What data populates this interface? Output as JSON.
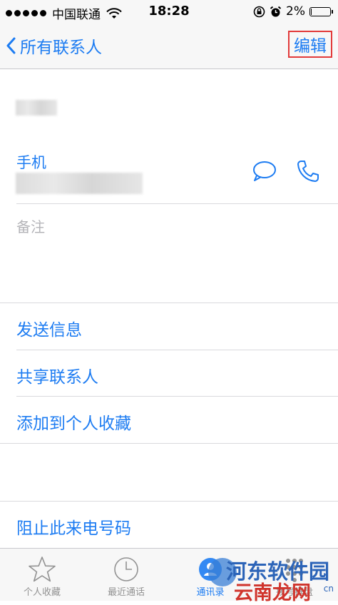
{
  "status_bar": {
    "carrier": "中国联通",
    "time": "18:28",
    "battery": "2%",
    "battery_level": 0.02
  },
  "nav": {
    "back_label": "所有联系人",
    "edit_label": "编辑"
  },
  "contact": {
    "phone_label": "手机",
    "notes_placeholder": "备注"
  },
  "actions": {
    "send_message": "发送信息",
    "share_contact": "共享联系人",
    "add_favorite": "添加到个人收藏",
    "block_caller": "阻止此来电号码"
  },
  "tabs": [
    {
      "label": "个人收藏",
      "icon": "star-icon"
    },
    {
      "label": "最近通话",
      "icon": "clock-icon"
    },
    {
      "label": "通讯录",
      "icon": "contacts-icon",
      "active": true
    },
    {
      "label": "拨号键盘",
      "icon": "keypad-icon"
    }
  ],
  "watermark": {
    "line1": "河东软件园",
    "line2": "云南龙网",
    "line3": "cn"
  },
  "colors": {
    "accent": "#1d7cf2",
    "highlight_border": "#e23a3a",
    "bar_bg": "#f7f7f7"
  }
}
